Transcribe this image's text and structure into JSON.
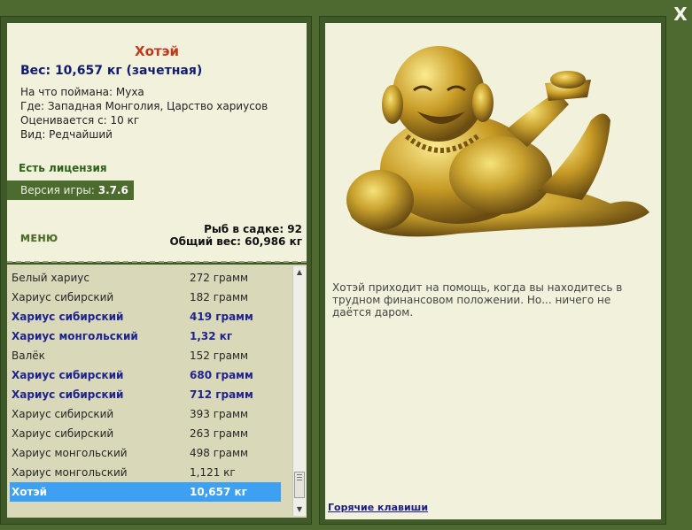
{
  "window": {
    "close_glyph": "X"
  },
  "fish": {
    "title": "Хотэй",
    "weight": "Вес: 10,657 кг (зачетная)",
    "bait": "На что поймана: Муха",
    "location": "Где: Западная Монголия, Царство хариусов",
    "rated_from": "Оценивается с: 10 кг",
    "kind": "Вид: Редчайший",
    "description": "Хотэй приходит на помощь, когда вы находитесь в трудном финансовом положении. Но... ничего не даётся даром."
  },
  "license": "Есть лицензия",
  "version": {
    "label": "Версия игры:",
    "value": "3.7.6"
  },
  "menu_label": "МЕНЮ",
  "stats": {
    "fish_count": "Рыб в садке: 92",
    "total_weight": "Общий вес: 60,986 кг"
  },
  "catch_list": [
    {
      "name": "Белый хариус",
      "weight": "272 грамм",
      "style": "normal"
    },
    {
      "name": "Хариус сибирский",
      "weight": "182 грамм",
      "style": "normal"
    },
    {
      "name": "Хариус сибирский",
      "weight": "419 грамм",
      "style": "bold"
    },
    {
      "name": "Хариус монгольский",
      "weight": "1,32 кг",
      "style": "bold"
    },
    {
      "name": "Валёк",
      "weight": "152 грамм",
      "style": "normal"
    },
    {
      "name": "Хариус сибирский",
      "weight": "680 грамм",
      "style": "bold"
    },
    {
      "name": "Хариус сибирский",
      "weight": "712 грамм",
      "style": "bold"
    },
    {
      "name": "Хариус сибирский",
      "weight": "393 грамм",
      "style": "normal"
    },
    {
      "name": "Хариус сибирский",
      "weight": "263 грамм",
      "style": "normal"
    },
    {
      "name": "Хариус монгольский",
      "weight": "498 грамм",
      "style": "normal"
    },
    {
      "name": "Хариус монгольский",
      "weight": "1,121 кг",
      "style": "normal"
    },
    {
      "name": "Хотэй",
      "weight": "10,657 кг",
      "style": "selected"
    }
  ],
  "hotkeys_link": "Горячие клавиши",
  "colors": {
    "accent_title": "#c0391b",
    "selected_row": "#3ea0f2",
    "panel_green": "#3f5a28"
  }
}
